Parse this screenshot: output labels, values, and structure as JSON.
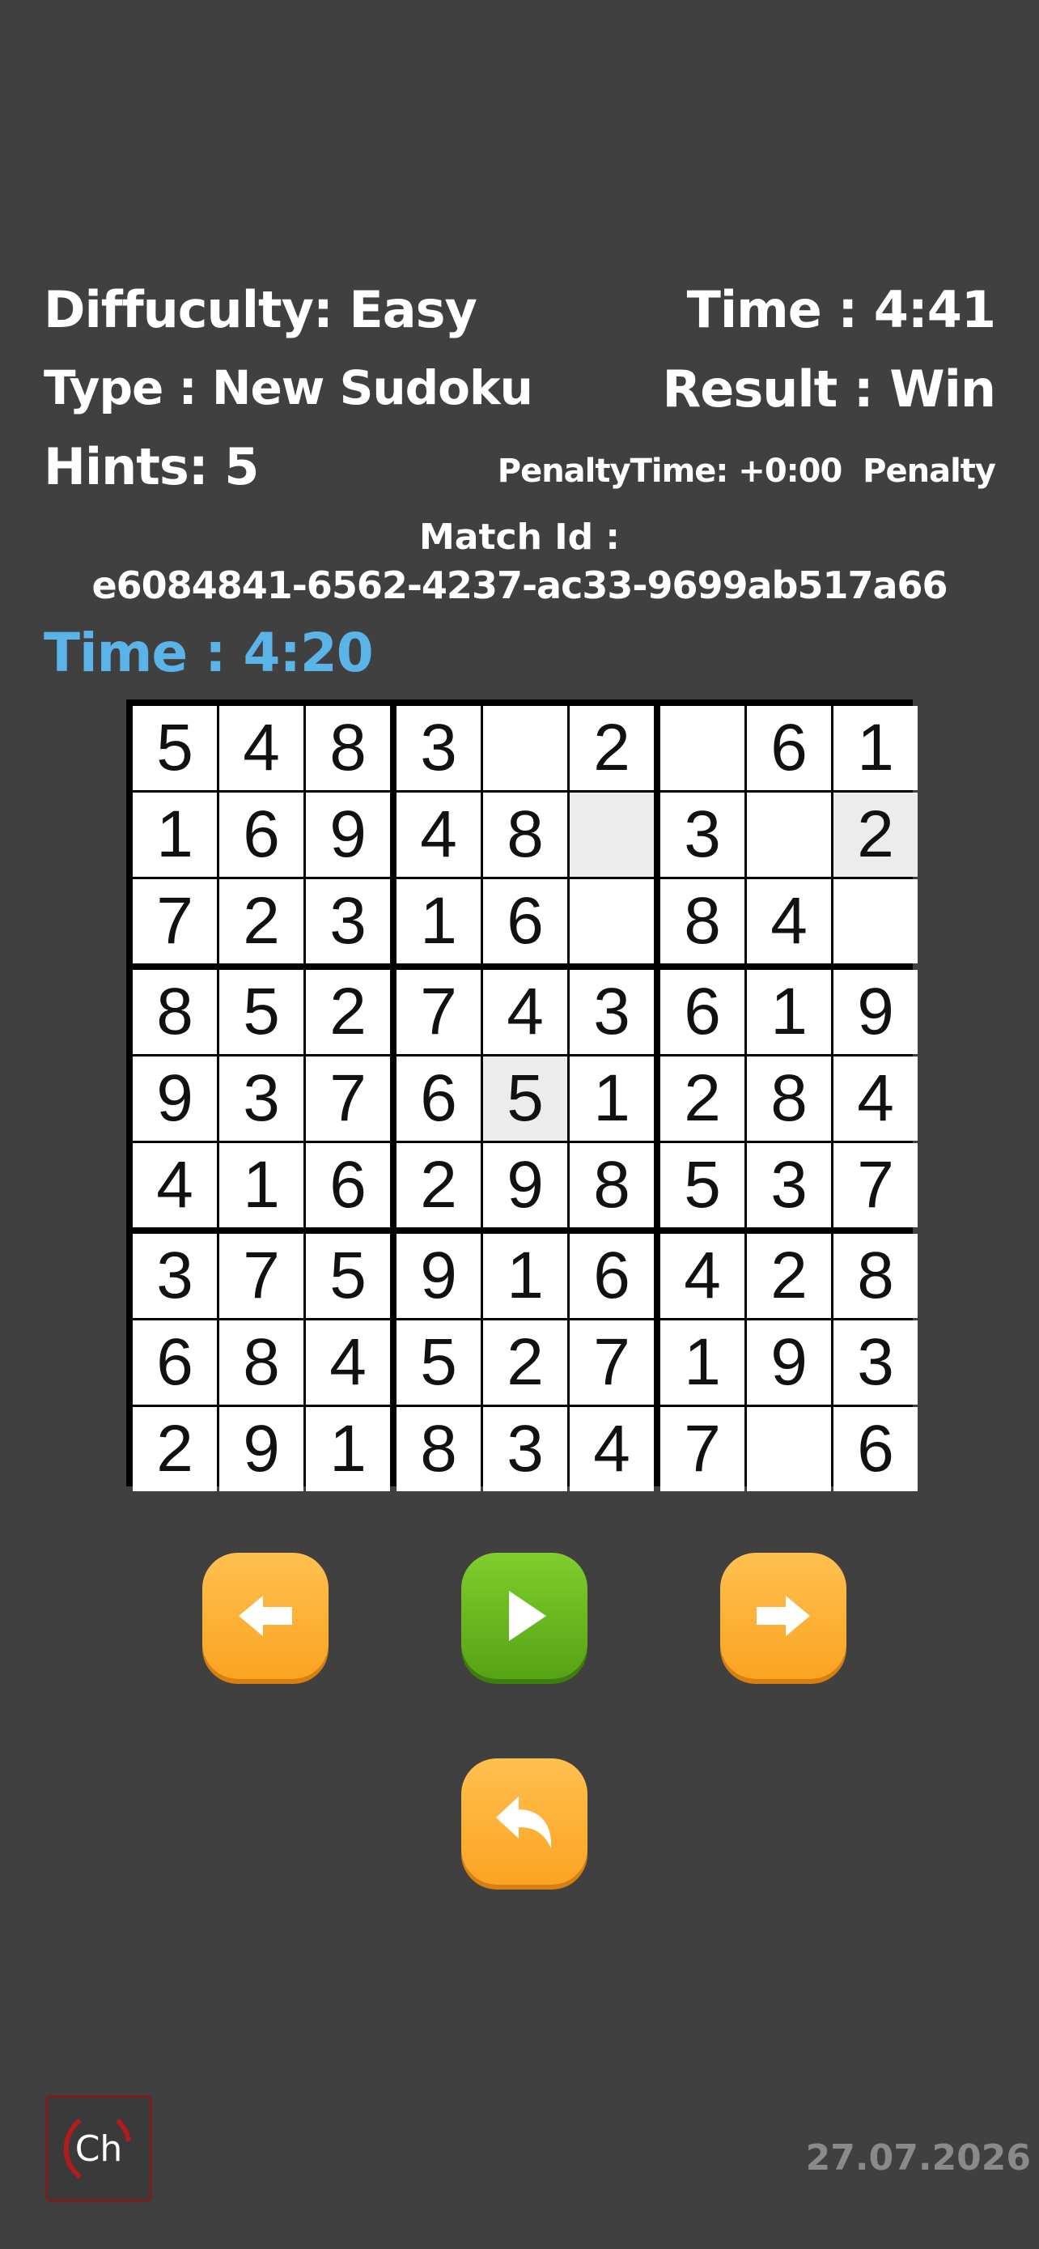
{
  "header": {
    "difficulty": "Diffuculty: Easy",
    "time": "Time : 4:41",
    "type": "Type : New Sudoku",
    "result": "Result : Win",
    "hints": "Hints: 5",
    "penalty_time": "PenaltyTime: +0:00",
    "penalty": "Penalty"
  },
  "match": {
    "label": "Match Id :",
    "id": "e6084841-6562-4237-ac33-9699ab517a66"
  },
  "timer": "Time : 4:20",
  "board": {
    "rows": [
      [
        "5",
        "4",
        "8",
        "3",
        "",
        "2",
        "",
        "6",
        "1"
      ],
      [
        "1",
        "6",
        "9",
        "4",
        "8",
        "",
        "3",
        "",
        "2"
      ],
      [
        "7",
        "2",
        "3",
        "1",
        "6",
        "",
        "8",
        "4",
        ""
      ],
      [
        "8",
        "5",
        "2",
        "7",
        "4",
        "3",
        "6",
        "1",
        "9"
      ],
      [
        "9",
        "3",
        "7",
        "6",
        "5",
        "1",
        "2",
        "8",
        "4"
      ],
      [
        "4",
        "1",
        "6",
        "2",
        "9",
        "8",
        "5",
        "3",
        "7"
      ],
      [
        "3",
        "7",
        "5",
        "9",
        "1",
        "6",
        "4",
        "2",
        "8"
      ],
      [
        "6",
        "8",
        "4",
        "5",
        "2",
        "7",
        "1",
        "9",
        "3"
      ],
      [
        "2",
        "9",
        "1",
        "8",
        "3",
        "4",
        "7",
        "",
        "6"
      ]
    ],
    "highlighted_cells": [
      [
        1,
        5
      ],
      [
        1,
        8
      ],
      [
        4,
        4
      ]
    ]
  },
  "controls": {
    "back_icon": "arrow-left-icon",
    "play_icon": "play-icon",
    "forward_icon": "arrow-right-icon",
    "return_icon": "return-arrow-icon"
  },
  "footer": {
    "badge": "Ch",
    "date": "27.07.2026"
  },
  "colors": {
    "background": "#404040",
    "timer": "#5ab4e8",
    "button_orange": "#fba422",
    "button_green": "#56a315"
  }
}
